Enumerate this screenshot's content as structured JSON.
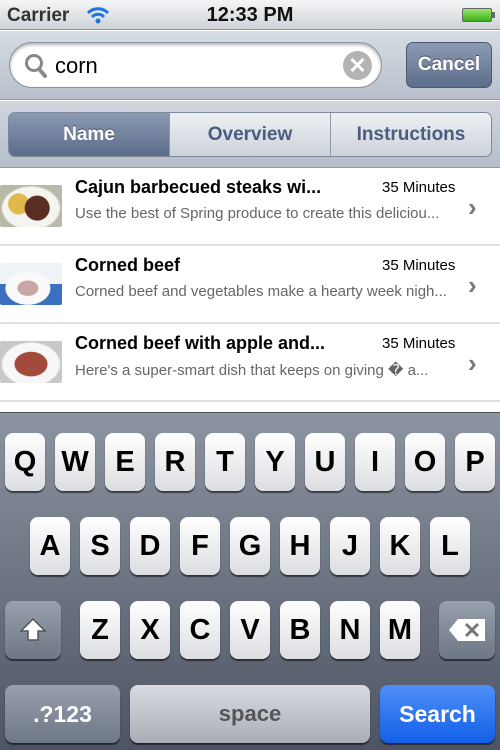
{
  "status": {
    "carrier": "Carrier",
    "time": "12:33 PM",
    "wifi_icon": "wifi-icon",
    "battery_icon": "battery-icon"
  },
  "search": {
    "value": "corn",
    "placeholder": "",
    "cancel_label": "Cancel"
  },
  "segments": [
    {
      "label": "Name",
      "selected": true
    },
    {
      "label": "Overview",
      "selected": false
    },
    {
      "label": "Instructions",
      "selected": false
    }
  ],
  "results": [
    {
      "title": "Cajun barbecued steaks wi...",
      "duration": "35 Minutes",
      "description": "Use the best of Spring produce to create this deliciou..."
    },
    {
      "title": "Corned beef",
      "duration": "35 Minutes",
      "description": "Corned beef and vegetables make a hearty week nigh..."
    },
    {
      "title": "Corned beef with apple and...",
      "duration": "35 Minutes",
      "description": "Here's a super-smart dish that keeps on giving � a..."
    }
  ],
  "keyboard": {
    "row1": [
      "Q",
      "W",
      "E",
      "R",
      "T",
      "Y",
      "U",
      "I",
      "O",
      "P"
    ],
    "row2": [
      "A",
      "S",
      "D",
      "F",
      "G",
      "H",
      "J",
      "K",
      "L"
    ],
    "row3": [
      "Z",
      "X",
      "C",
      "V",
      "B",
      "N",
      "M"
    ],
    "numbers_label": ".?123",
    "space_label": "space",
    "search_label": "Search",
    "accent": "#1a66ea"
  }
}
